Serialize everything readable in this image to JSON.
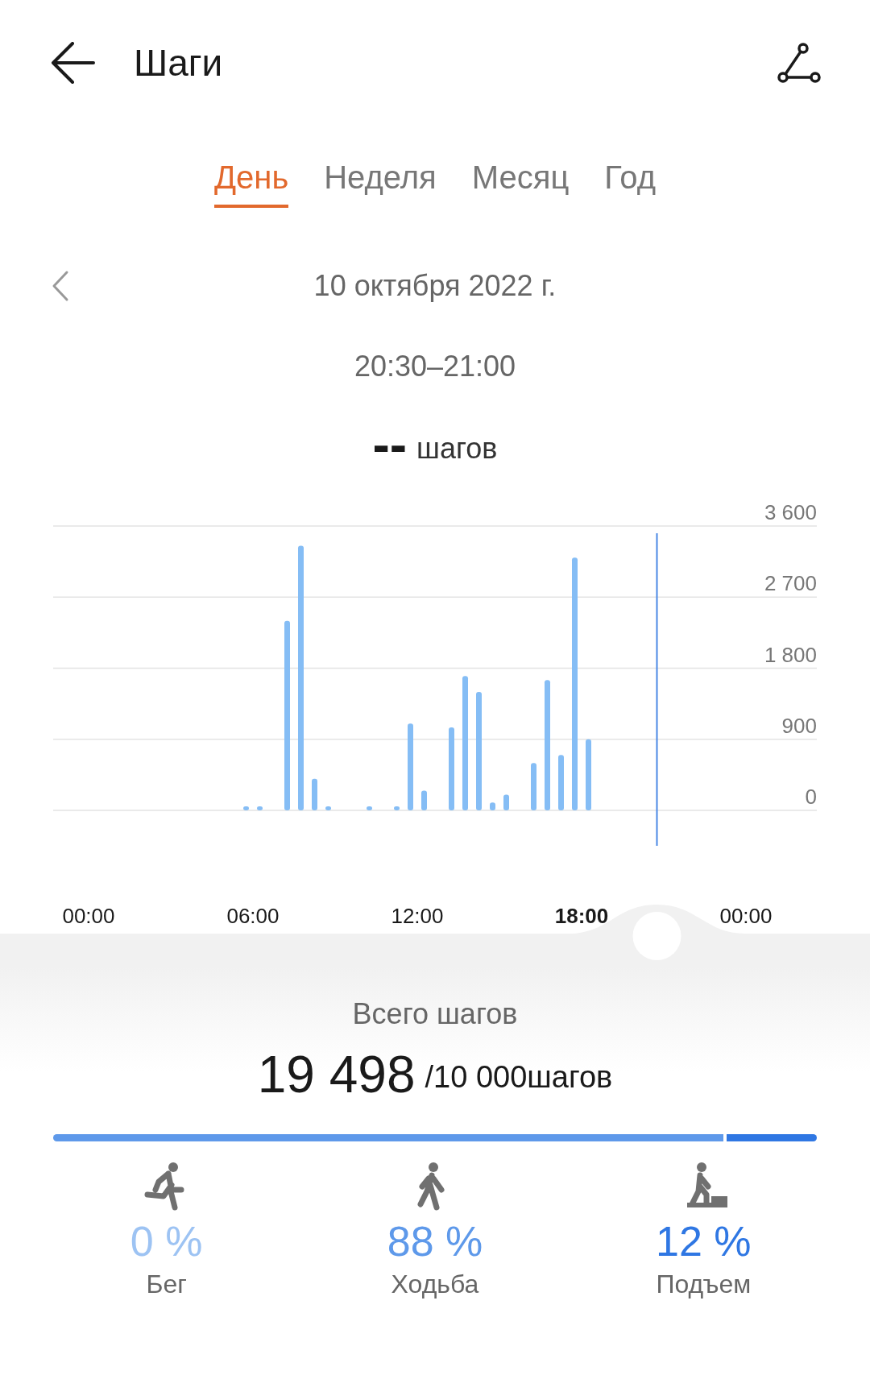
{
  "header": {
    "title": "Шаги"
  },
  "tabs": [
    {
      "label": "День",
      "selected": true
    },
    {
      "label": "Неделя",
      "selected": false
    },
    {
      "label": "Месяц",
      "selected": false
    },
    {
      "label": "Год",
      "selected": false
    }
  ],
  "date": "10 октября 2022 г.",
  "time_range": "20:30–21:00",
  "selected_steps": {
    "value": "--",
    "unit": "шагов"
  },
  "chart_data": {
    "type": "bar",
    "grid": true,
    "x": [
      5.75,
      6.25,
      7.25,
      7.75,
      8.25,
      8.75,
      10.25,
      11.25,
      11.75,
      12.25,
      13.25,
      13.75,
      14.25,
      14.75,
      15.25,
      16.25,
      16.75,
      17.25,
      17.75,
      18.25
    ],
    "values": [
      50,
      50,
      2400,
      3350,
      400,
      50,
      50,
      50,
      1100,
      250,
      1050,
      1700,
      1500,
      100,
      200,
      600,
      1650,
      700,
      3200,
      900
    ],
    "xlim": [
      0,
      24
    ],
    "ylim": [
      0,
      3600
    ],
    "xticks": [
      {
        "value": 0,
        "label": "00:00"
      },
      {
        "value": 6,
        "label": "06:00"
      },
      {
        "value": 12,
        "label": "12:00"
      },
      {
        "value": 18,
        "label": "18:00"
      },
      {
        "value": 24,
        "label": "00:00"
      }
    ],
    "yticks": [
      {
        "value": 0,
        "label": "0"
      },
      {
        "value": 900,
        "label": "900"
      },
      {
        "value": 1800,
        "label": "1 800"
      },
      {
        "value": 2700,
        "label": "2 700"
      },
      {
        "value": 3600,
        "label": "3 600"
      }
    ],
    "ref_lines": [
      {
        "axis": "x",
        "value": 20.75
      }
    ]
  },
  "total": {
    "label": "Всего шагов",
    "value": "19 498",
    "goal": "/10 000шагов"
  },
  "activities": [
    {
      "kind": "running",
      "percent": "0 %",
      "label": "Бег",
      "color": "#9dc3f3"
    },
    {
      "kind": "walking",
      "percent": "88 %",
      "label": "Ходьба",
      "color": "#5e99ea"
    },
    {
      "kind": "climbing",
      "percent": "12 %",
      "label": "Подъем",
      "color": "#2f77e3"
    }
  ]
}
